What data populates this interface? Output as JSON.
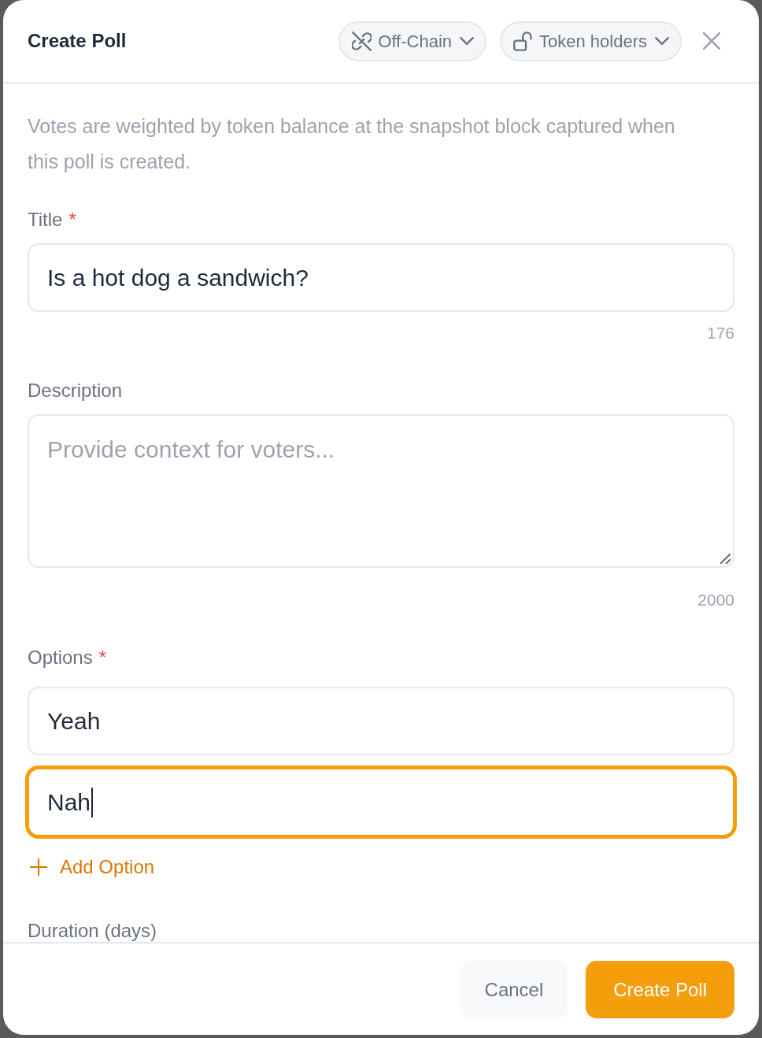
{
  "dialog": {
    "title": "Create Poll",
    "chips": [
      {
        "kind": "chain",
        "label": "Off-Chain"
      },
      {
        "kind": "access",
        "label": "Token holders"
      }
    ]
  },
  "notice": "Votes are weighted by token balance at the snapshot block captured when this poll is created.",
  "form": [
    {
      "kind": "text",
      "label": "Title",
      "required_mark": "*",
      "value": "Is a hot dog a sandwich?",
      "counter": "176"
    },
    {
      "kind": "textarea",
      "label": "Description",
      "placeholder": "Provide context for voters...",
      "counter": "2000"
    },
    {
      "kind": "options",
      "label": "Options",
      "required_mark": "*",
      "options": [
        {
          "value": "Yeah",
          "focused": false
        },
        {
          "value": "Nah",
          "focused": true
        }
      ],
      "add_label": "Add Option"
    },
    {
      "kind": "label",
      "label": "Duration (days)"
    }
  ],
  "footer": {
    "buttons": [
      {
        "kind": "secondary",
        "label": "Cancel"
      },
      {
        "kind": "primary",
        "label": "Create Poll"
      }
    ]
  }
}
